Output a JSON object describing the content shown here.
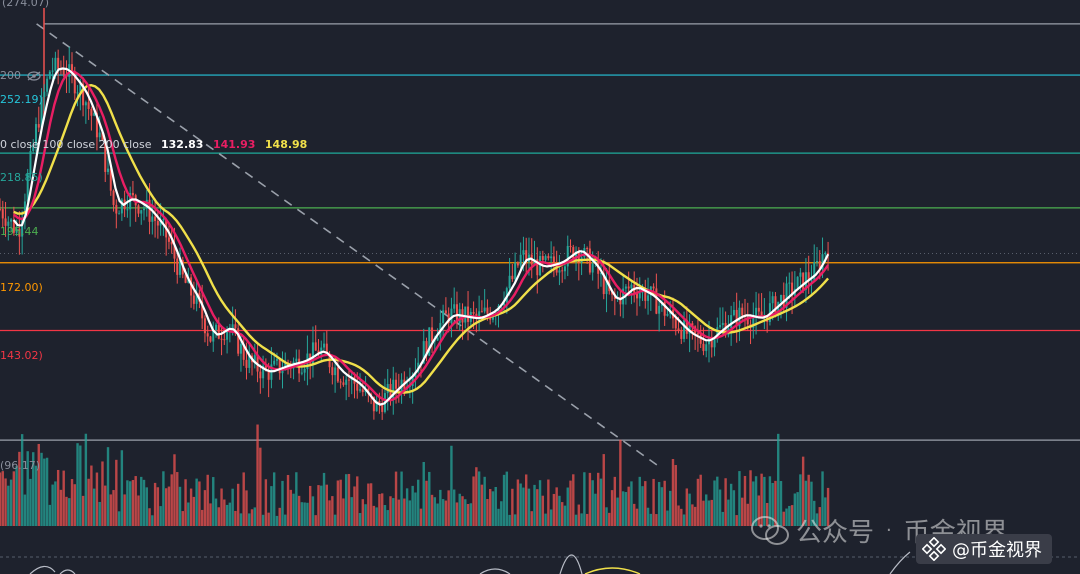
{
  "price_labels": {
    "top": "(274.07)",
    "fib": [
      "252.19)",
      "218.85)",
      "195.44",
      "172.00)",
      "143.02)",
      "(96.17)"
    ]
  },
  "ma_legend": {
    "text": "0 close 100 close 200 close",
    "values": [
      "132.83",
      "141.93",
      "148.98"
    ]
  },
  "indicator_label": "200",
  "watermark": {
    "text": "公众号",
    "dot": "·",
    "brand": "币金视界"
  },
  "badge": {
    "text": "@币金视界"
  },
  "colors": {
    "background": "#1e222d",
    "up": "#26a69a",
    "down": "#ef5350",
    "ma_fast": "#ffffff",
    "ma_mid": "#e91e63",
    "ma_slow": "#f0e04a",
    "fib_lines": [
      "#9aa0aa",
      "#26c6da",
      "#1fa99a",
      "#4caf50",
      "#ff9800",
      "#f23645",
      "#9aa0aa"
    ],
    "fib_label_colors": [
      "#26c6da",
      "#26a69a",
      "#4caf50",
      "#ff9800",
      "#f23645",
      "#8a8f9c"
    ]
  },
  "chart_data": {
    "type": "candlestick",
    "ylim": [
      80,
      280
    ],
    "fib_levels": [
      274.07,
      252.19,
      218.85,
      195.44,
      172.0,
      143.02,
      96.17
    ],
    "trendline": {
      "from": [
        0.04,
        274.07
      ],
      "to": [
        0.72,
        85
      ]
    },
    "price_path": [
      [
        0.0,
        195
      ],
      [
        0.02,
        185
      ],
      [
        0.04,
        230
      ],
      [
        0.055,
        255
      ],
      [
        0.07,
        255
      ],
      [
        0.09,
        245
      ],
      [
        0.11,
        225
      ],
      [
        0.125,
        195
      ],
      [
        0.14,
        200
      ],
      [
        0.16,
        195
      ],
      [
        0.18,
        185
      ],
      [
        0.2,
        165
      ],
      [
        0.215,
        155
      ],
      [
        0.23,
        140
      ],
      [
        0.25,
        145
      ],
      [
        0.27,
        130
      ],
      [
        0.29,
        125
      ],
      [
        0.31,
        128
      ],
      [
        0.33,
        130
      ],
      [
        0.35,
        135
      ],
      [
        0.37,
        125
      ],
      [
        0.39,
        120
      ],
      [
        0.41,
        110
      ],
      [
        0.43,
        118
      ],
      [
        0.45,
        125
      ],
      [
        0.47,
        140
      ],
      [
        0.49,
        150
      ],
      [
        0.52,
        148
      ],
      [
        0.54,
        152
      ],
      [
        0.56,
        165
      ],
      [
        0.57,
        175
      ],
      [
        0.59,
        170
      ],
      [
        0.61,
        172
      ],
      [
        0.63,
        178
      ],
      [
        0.65,
        170
      ],
      [
        0.67,
        155
      ],
      [
        0.69,
        162
      ],
      [
        0.71,
        158
      ],
      [
        0.73,
        150
      ],
      [
        0.75,
        142
      ],
      [
        0.77,
        138
      ],
      [
        0.79,
        145
      ],
      [
        0.81,
        150
      ],
      [
        0.83,
        148
      ],
      [
        0.85,
        155
      ],
      [
        0.87,
        162
      ],
      [
        0.89,
        168
      ],
      [
        0.905,
        180
      ]
    ],
    "ma_offsets": {
      "fast": 0.012,
      "mid": 0.028,
      "slow": 0.06
    },
    "volume_max": 124
  }
}
